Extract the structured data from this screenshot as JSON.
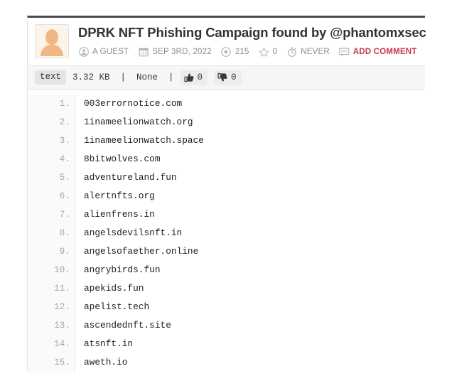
{
  "paste": {
    "title": "DPRK NFT Phishing Campaign found by @phantomxsec",
    "avatar_icon": "default-user-avatar-icon",
    "meta": [
      {
        "icon": "user-circle-icon",
        "label": "A GUEST",
        "name": "author"
      },
      {
        "icon": "calendar-icon",
        "label": "SEP 3RD, 2022",
        "name": "date"
      },
      {
        "icon": "eye-icon",
        "label": "215",
        "name": "views"
      },
      {
        "icon": "star-icon",
        "label": "0",
        "name": "favorites"
      },
      {
        "icon": "stopwatch-icon",
        "label": "NEVER",
        "name": "expiry"
      },
      {
        "icon": "comment-icon",
        "label": "ADD COMMENT",
        "name": "add-comment"
      }
    ],
    "toolbar": {
      "format_chip": "text",
      "info": "3.32 KB  |  None  |",
      "size": "3.32 KB",
      "category": "None",
      "like_icon": "thumbs-up-icon",
      "like_count": "0",
      "dislike_icon": "thumbs-down-icon",
      "dislike_count": "0"
    },
    "colors": {
      "accent_red": "#c9384a",
      "title": "#333333",
      "meta": "#8c8c8c",
      "toolbar_bg": "#f6f6f6",
      "gutter_bg": "#fafafa"
    },
    "lines": [
      {
        "n": "1.",
        "text": "003errornotice.com"
      },
      {
        "n": "2.",
        "text": "1inameelionwatch.org"
      },
      {
        "n": "3.",
        "text": "1inameelionwatch.space"
      },
      {
        "n": "4.",
        "text": "8bitwolves.com"
      },
      {
        "n": "5.",
        "text": "adventureland.fun"
      },
      {
        "n": "6.",
        "text": "alertnfts.org"
      },
      {
        "n": "7.",
        "text": "alienfrens.in"
      },
      {
        "n": "8.",
        "text": "angelsdevilsnft.in"
      },
      {
        "n": "9.",
        "text": "angelsofaether.online"
      },
      {
        "n": "10.",
        "text": "angrybirds.fun"
      },
      {
        "n": "11.",
        "text": "apekids.fun"
      },
      {
        "n": "12.",
        "text": "apelist.tech"
      },
      {
        "n": "13.",
        "text": "ascendednft.site"
      },
      {
        "n": "14.",
        "text": "atsnft.in"
      },
      {
        "n": "15.",
        "text": "aweth.io"
      }
    ]
  }
}
